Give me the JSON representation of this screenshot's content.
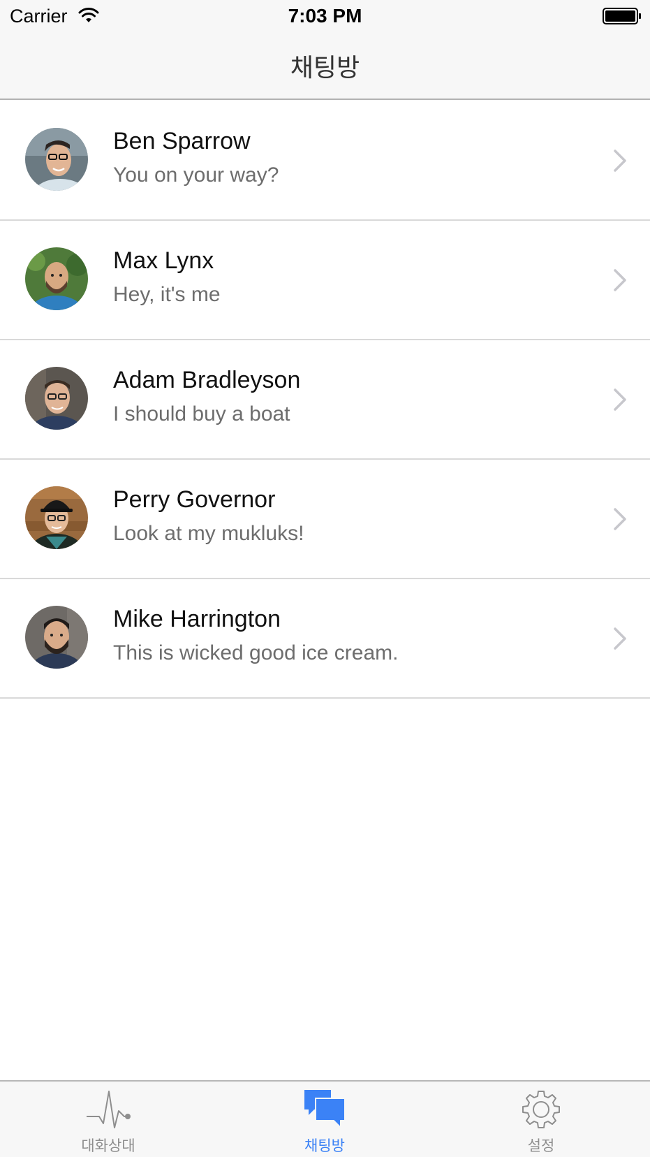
{
  "status_bar": {
    "carrier": "Carrier",
    "time": "7:03 PM"
  },
  "nav": {
    "title": "채팅방"
  },
  "chats": [
    {
      "name": "Ben Sparrow",
      "preview": "You on your way?"
    },
    {
      "name": "Max Lynx",
      "preview": "Hey, it's me"
    },
    {
      "name": "Adam Bradleyson",
      "preview": "I should buy a boat"
    },
    {
      "name": "Perry Governor",
      "preview": "Look at my mukluks!"
    },
    {
      "name": "Mike Harrington",
      "preview": "This is wicked good ice cream."
    }
  ],
  "tabs": [
    {
      "label": "대화상대",
      "icon": "pulse-icon"
    },
    {
      "label": "채팅방",
      "icon": "chat-bubbles-icon",
      "active": true
    },
    {
      "label": "설정",
      "icon": "gear-icon"
    }
  ],
  "colors": {
    "accent": "#3b82f6",
    "inactive": "#8e8e8e",
    "bar_background": "#f7f7f7"
  }
}
